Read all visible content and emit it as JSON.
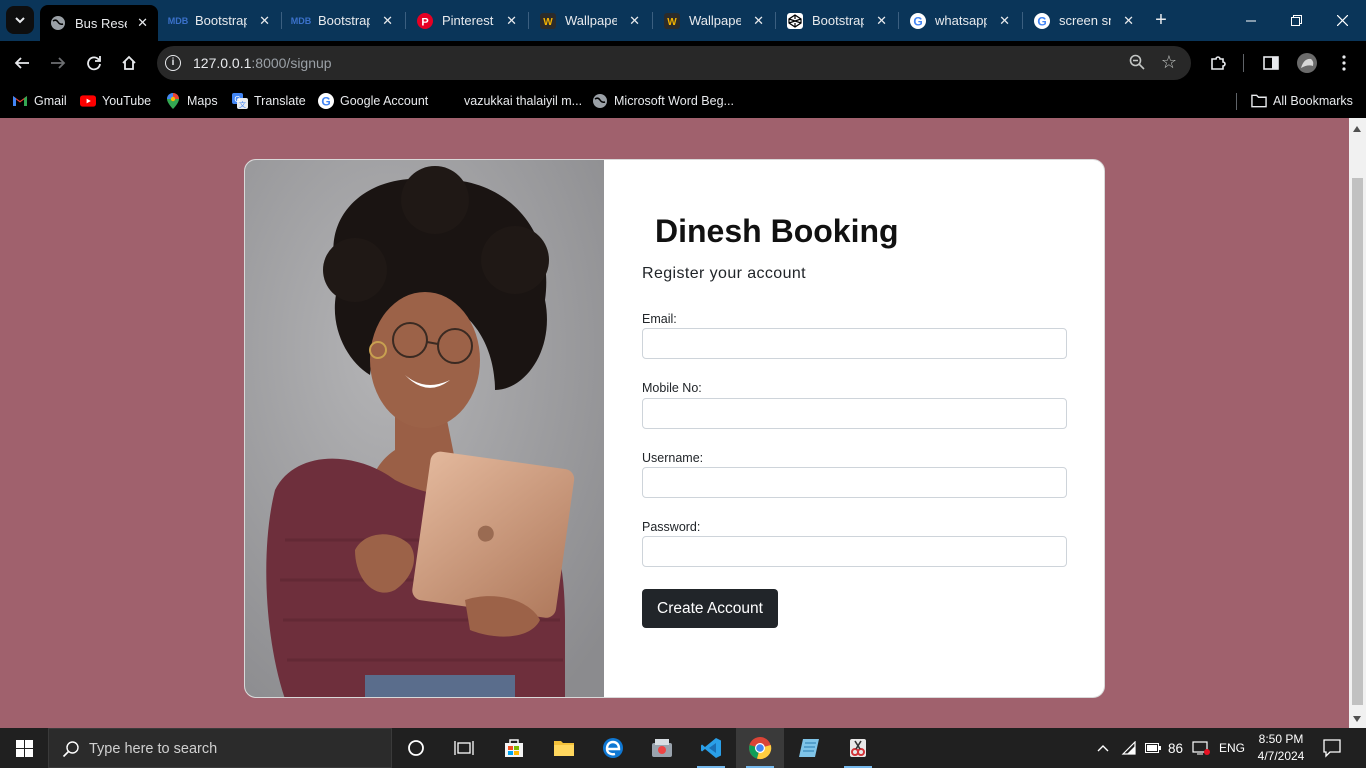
{
  "browser": {
    "tabs": [
      {
        "title": "Bus Reser",
        "favicon": "globe-icon",
        "active": true
      },
      {
        "title": "Bootstrap",
        "favicon": "mdb-icon"
      },
      {
        "title": "Bootstrap",
        "favicon": "mdb-icon"
      },
      {
        "title": "Pinterest",
        "favicon": "pinterest-icon"
      },
      {
        "title": "Wallpaper",
        "favicon": "wallpaper-icon"
      },
      {
        "title": "Wallpaper",
        "favicon": "wallpaper-icon"
      },
      {
        "title": "Bootstrap",
        "favicon": "codepen-icon"
      },
      {
        "title": "whatsapp",
        "favicon": "google-icon"
      },
      {
        "title": "screen sni",
        "favicon": "google-icon"
      }
    ],
    "address": {
      "host": "127.0.0.1",
      "path": ":8000/signup"
    },
    "bookmarks": [
      {
        "label": "Gmail",
        "icon": "gmail-icon"
      },
      {
        "label": "YouTube",
        "icon": "youtube-icon"
      },
      {
        "label": "Maps",
        "icon": "maps-icon"
      },
      {
        "label": "Translate",
        "icon": "translate-icon"
      },
      {
        "label": "Google Account",
        "icon": "google-icon"
      },
      {
        "label": "vazukkai thalaiyil m...",
        "icon": "blank-icon"
      },
      {
        "label": "Microsoft Word Beg...",
        "icon": "globe-icon"
      }
    ],
    "all_bookmarks": "All Bookmarks"
  },
  "signup": {
    "brand": "Dinesh Booking",
    "subtitle": "Register your account",
    "fields": {
      "email": {
        "label": "Email:",
        "value": ""
      },
      "mobile": {
        "label": "Mobile No:",
        "value": ""
      },
      "username": {
        "label": "Username:",
        "value": ""
      },
      "password": {
        "label": "Password:",
        "value": ""
      }
    },
    "submit": "Create Account"
  },
  "taskbar": {
    "search_placeholder": "Type here to search",
    "battery": "86",
    "language": "ENG",
    "time": "8:50 PM",
    "date": "4/7/2024"
  },
  "colors": {
    "page_background": "#a0616d",
    "tabstrip": "#0a3559",
    "button_dark": "#212529"
  }
}
